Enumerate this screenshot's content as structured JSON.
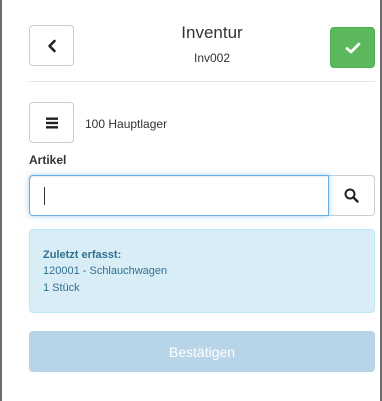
{
  "header": {
    "title": "Inventur",
    "subtitle": "Inv002",
    "back_icon": "chevron-left-icon",
    "confirm_icon": "check-icon"
  },
  "location": {
    "menu_icon": "menu-icon",
    "warehouse": "100 Hauptlager"
  },
  "article": {
    "label": "Artikel",
    "value": "",
    "search_icon": "search-icon"
  },
  "last_recorded": {
    "title": "Zuletzt erfasst:",
    "item": "120001 - Schlauchwagen",
    "quantity": "1 Stück"
  },
  "submit": {
    "label": "Bestätigen"
  },
  "colors": {
    "success": "#5cb85c",
    "info_bg": "#d9edf7",
    "info_text": "#31708f",
    "primary_disabled": "#b8d4e8",
    "focus": "#66afe9"
  }
}
